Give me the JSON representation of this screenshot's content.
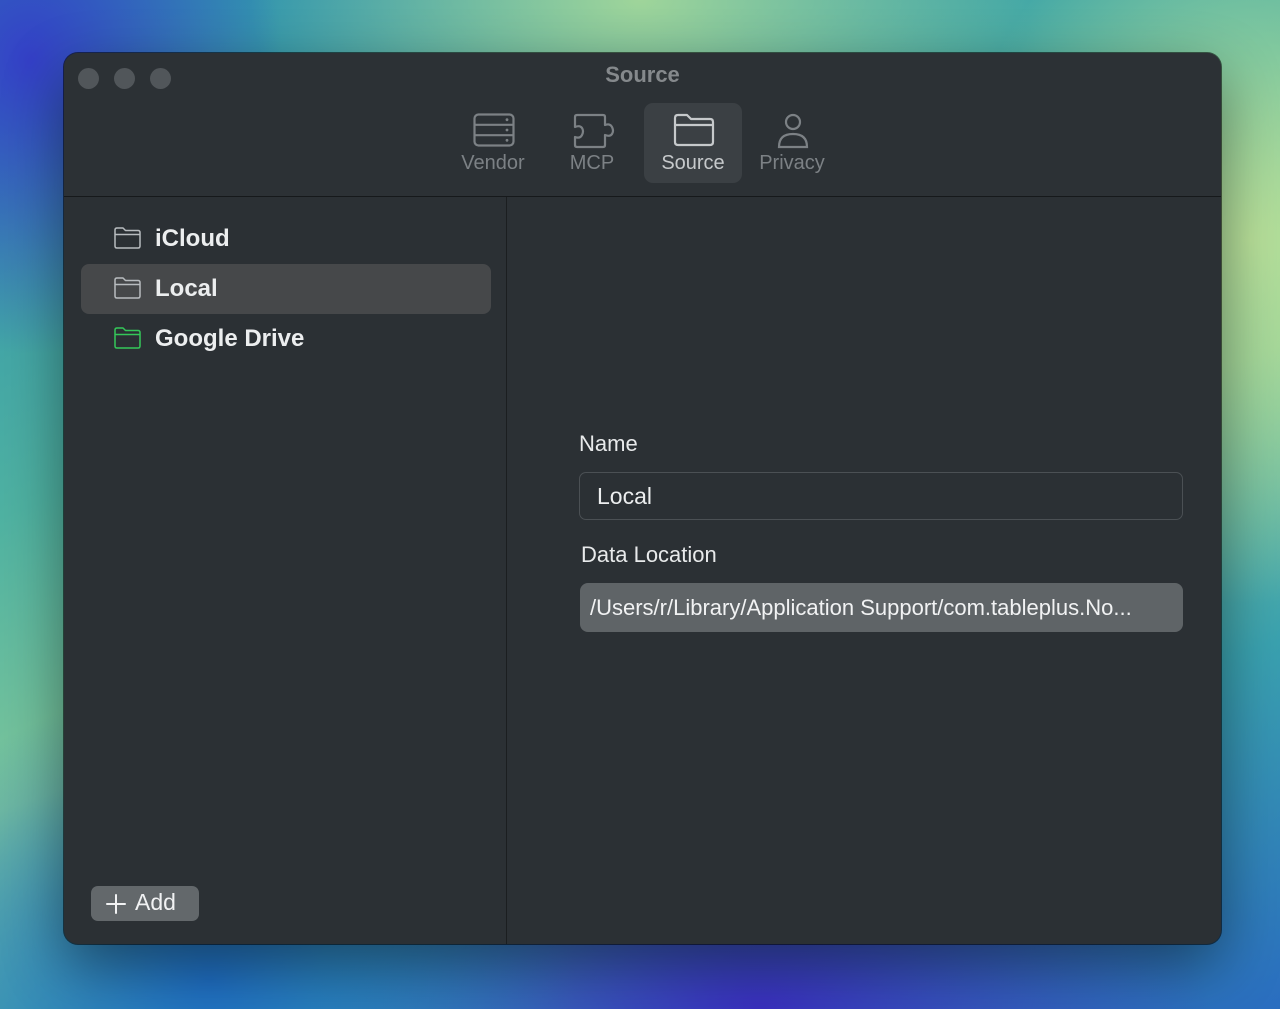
{
  "window": {
    "title": "Source"
  },
  "toolbar": {
    "tabs": [
      {
        "label": "Vendor",
        "icon": "server-icon",
        "selected": false
      },
      {
        "label": "MCP",
        "icon": "puzzle-icon",
        "selected": false
      },
      {
        "label": "Source",
        "icon": "folder-icon",
        "selected": true
      },
      {
        "label": "Privacy",
        "icon": "person-icon",
        "selected": false
      }
    ]
  },
  "sidebar": {
    "items": [
      {
        "label": "iCloud",
        "icon": "folder-icon",
        "selected": false
      },
      {
        "label": "Local",
        "icon": "folder-icon",
        "selected": true
      },
      {
        "label": "Google Drive",
        "icon": "folder-icon",
        "icon_color": "#34c759",
        "selected": false
      }
    ],
    "add_label": "Add"
  },
  "detail": {
    "name_label": "Name",
    "name_value": "Local",
    "location_label": "Data Location",
    "location_value": "/Users/r/Library/Application Support/com.tableplus.No..."
  },
  "colors": {
    "window_bg": "#2b3034",
    "selection": "#46484a",
    "google_folder": "#34c759"
  }
}
